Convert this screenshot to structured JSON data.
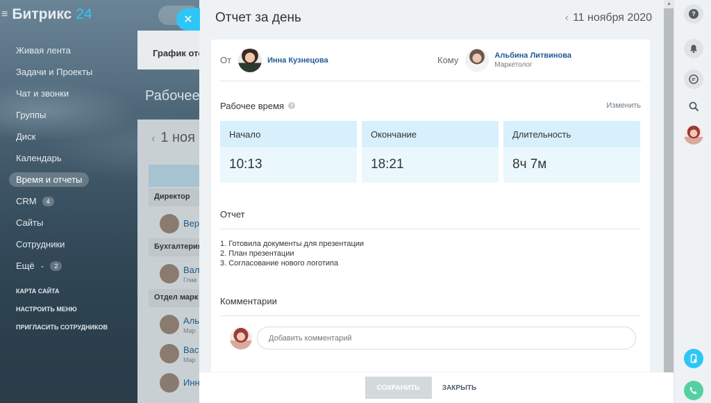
{
  "app": {
    "logo_name": "Битрикс",
    "logo_num": "24"
  },
  "sidebar": {
    "items": [
      {
        "label": "Живая лента"
      },
      {
        "label": "Задачи и Проекты"
      },
      {
        "label": "Чат и звонки"
      },
      {
        "label": "Группы"
      },
      {
        "label": "Диск"
      },
      {
        "label": "Календарь"
      },
      {
        "label": "Время и отчеты"
      },
      {
        "label": "CRM",
        "badge": "4"
      },
      {
        "label": "Сайты"
      },
      {
        "label": "Сотрудники"
      },
      {
        "label": "Ещё",
        "badge": "2"
      }
    ],
    "links": [
      "КАРТА САЙТА",
      "НАСТРОИТЬ МЕНЮ",
      "ПРИГЛАСИТЬ СОТРУДНИКОВ"
    ]
  },
  "background": {
    "card_title": "График отс",
    "page_title": "Рабочее",
    "date": "1 ноя",
    "groups": [
      "Директор",
      "Бухгалтерия",
      "Отдел марк"
    ],
    "people": [
      {
        "name": "Вер",
        "sub": ""
      },
      {
        "name": "Вал",
        "sub": "Глав"
      },
      {
        "name": "Аль",
        "sub": "Мар"
      },
      {
        "name": "Вас",
        "sub": "Мар"
      },
      {
        "name": "Инн",
        "sub": ""
      }
    ]
  },
  "report": {
    "title": "Отчет за день",
    "date": "11 ноября 2020",
    "from_label": "От",
    "from_name": "Инна Кузнецова",
    "to_label": "Кому",
    "to_name": "Альбина Литвинова",
    "to_position": "Маркетолог",
    "worktime_title": "Рабочее время",
    "change_link": "Изменить",
    "time": [
      {
        "label": "Начало",
        "value": "10:13"
      },
      {
        "label": "Окончание",
        "value": "18:21"
      },
      {
        "label": "Длительность",
        "value": "8ч 7м"
      }
    ],
    "report_title": "Отчет",
    "report_items": [
      "1. Готовила документы для презентации",
      "2. План презентации",
      "3. Согласование нового логотипа"
    ],
    "comments_title": "Комментарии",
    "comment_placeholder": "Добавить комментарий"
  },
  "footer": {
    "save_label": "СОХРАНИТЬ",
    "close_label": "ЗАКРЫТЬ"
  },
  "rightbar": {
    "icons": [
      "help-icon",
      "bell-icon",
      "chat-icon",
      "search-icon",
      "avatar",
      "mobile-icon",
      "phone-icon"
    ]
  },
  "colors": {
    "accent": "#2fc6f6",
    "link": "#1f5a96",
    "time_header": "#d7f0fb",
    "time_value": "#eaf8fd",
    "phone": "#55d0a0"
  }
}
